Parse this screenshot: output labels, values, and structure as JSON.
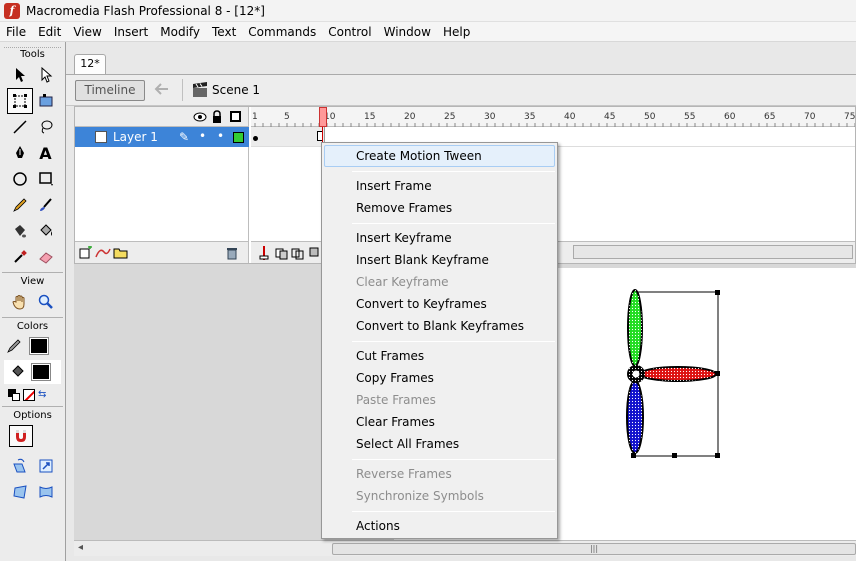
{
  "window": {
    "title": "Macromedia Flash Professional 8 - [12*]",
    "icon_text": "f"
  },
  "menubar": [
    "File",
    "Edit",
    "View",
    "Insert",
    "Modify",
    "Text",
    "Commands",
    "Control",
    "Window",
    "Help"
  ],
  "tools": {
    "title": "Tools",
    "view_title": "View",
    "colors_title": "Colors",
    "options_title": "Options",
    "icons": {
      "text_tool": "A"
    }
  },
  "document": {
    "tab_label": "12*",
    "timeline_button": "Timeline",
    "scene_label": "Scene 1"
  },
  "timeline": {
    "ruler_ticks": [
      "1",
      "5",
      "10",
      "15",
      "20",
      "25",
      "30",
      "35",
      "40",
      "45",
      "50",
      "55",
      "60",
      "65",
      "70",
      "75"
    ],
    "layer": {
      "name": "Layer 1",
      "pencil": "✎",
      "dot": "•",
      "color": "#33cc33"
    }
  },
  "context_menu": {
    "items": [
      {
        "label": "Create Motion Tween",
        "state": "highlight"
      },
      {
        "label": "Insert Frame",
        "state": "enabled"
      },
      {
        "label": "Remove Frames",
        "state": "enabled"
      },
      {
        "label": "Insert Keyframe",
        "state": "enabled"
      },
      {
        "label": "Insert Blank Keyframe",
        "state": "enabled"
      },
      {
        "label": "Clear Keyframe",
        "state": "disabled"
      },
      {
        "label": "Convert to Keyframes",
        "state": "enabled"
      },
      {
        "label": "Convert to Blank Keyframes",
        "state": "enabled"
      },
      {
        "label": "Cut Frames",
        "state": "enabled"
      },
      {
        "label": "Copy Frames",
        "state": "enabled"
      },
      {
        "label": "Paste Frames",
        "state": "disabled"
      },
      {
        "label": "Clear Frames",
        "state": "enabled"
      },
      {
        "label": "Select All Frames",
        "state": "enabled"
      },
      {
        "label": "Reverse Frames",
        "state": "disabled"
      },
      {
        "label": "Synchronize Symbols",
        "state": "disabled"
      },
      {
        "label": "Actions",
        "state": "enabled"
      }
    ]
  },
  "stage": {
    "propeller_colors": {
      "top": "#22dd22",
      "right": "#dd1111",
      "bottom": "#1111cc"
    }
  }
}
